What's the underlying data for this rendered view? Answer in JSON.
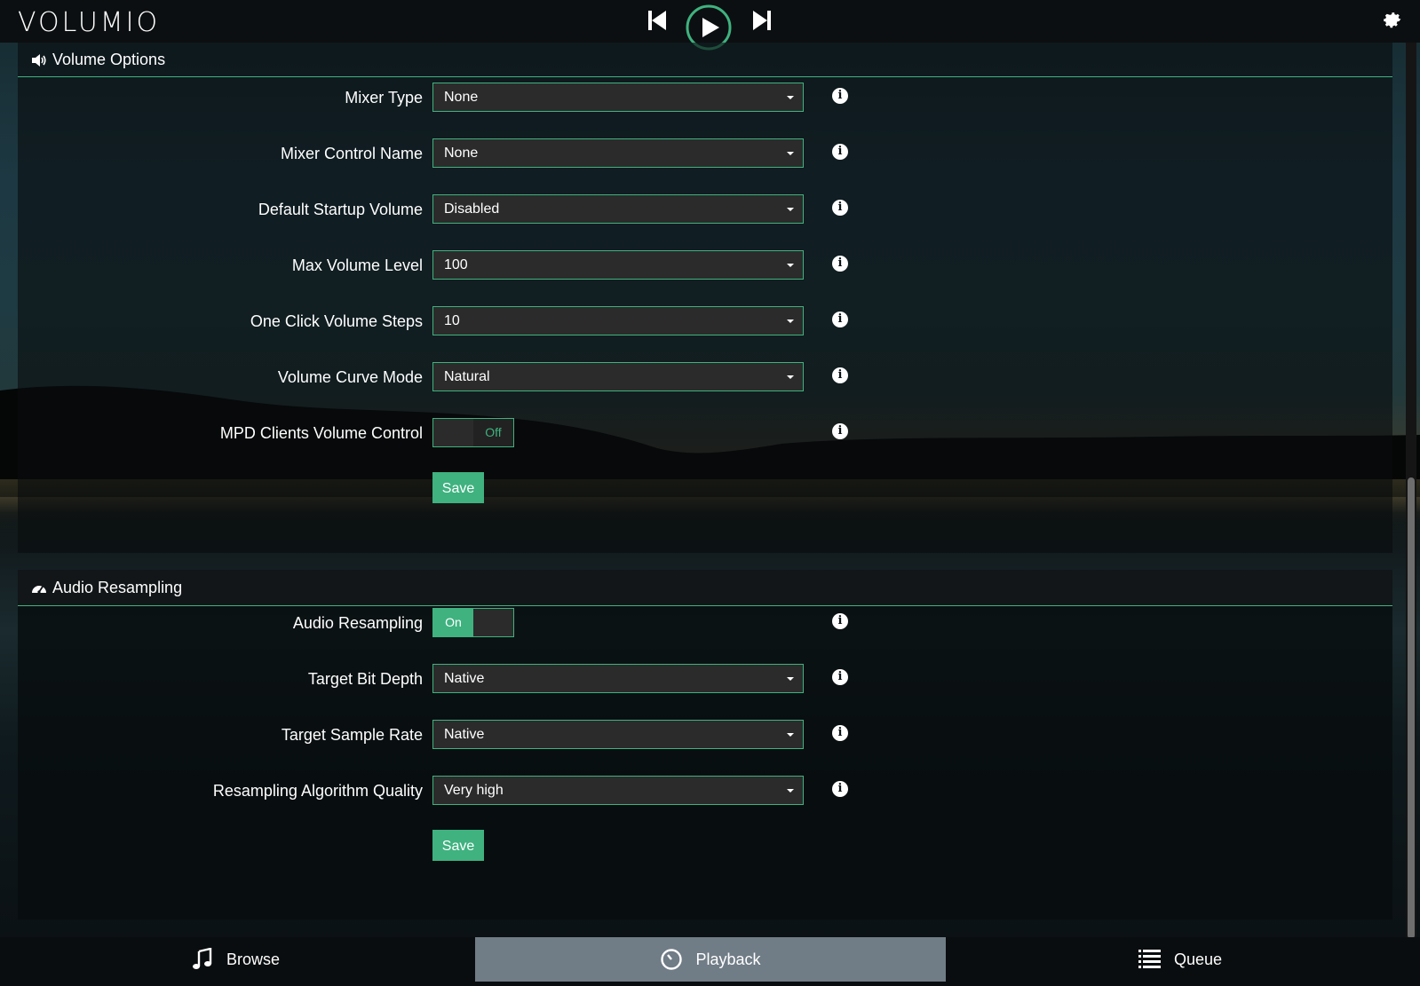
{
  "header": {
    "logo": "VOLUMIO",
    "controls": {
      "prev_icon": "skip-previous-icon",
      "play_icon": "play-icon",
      "next_icon": "skip-next-icon",
      "settings_icon": "gear-icon"
    }
  },
  "volume_options": {
    "title": "Volume Options",
    "icon": "volume-icon",
    "fields": [
      {
        "label": "Mixer Type",
        "value": "None"
      },
      {
        "label": "Mixer Control Name",
        "value": "None"
      },
      {
        "label": "Default Startup Volume",
        "value": "Disabled"
      },
      {
        "label": "Max Volume Level",
        "value": "100"
      },
      {
        "label": "One Click Volume Steps",
        "value": "10"
      },
      {
        "label": "Volume Curve Mode",
        "value": "Natural"
      }
    ],
    "mpd_toggle": {
      "label": "MPD Clients Volume Control",
      "on_text": "",
      "off_text": "Off",
      "state": "off"
    },
    "save_label": "Save"
  },
  "audio_resampling": {
    "title": "Audio Resampling",
    "icon": "dashboard-icon",
    "toggle": {
      "label": "Audio Resampling",
      "on_text": "On",
      "off_text": "",
      "state": "on"
    },
    "fields": [
      {
        "label": "Target Bit Depth",
        "value": "Native"
      },
      {
        "label": "Target Sample Rate",
        "value": "Native"
      },
      {
        "label": "Resampling Algorithm Quality",
        "value": "Very high"
      }
    ],
    "save_label": "Save"
  },
  "footer": {
    "tabs": [
      {
        "label": "Browse",
        "icon": "music-note-icon"
      },
      {
        "label": "Playback",
        "icon": "clock-icon",
        "active": true
      },
      {
        "label": "Queue",
        "icon": "list-icon"
      }
    ]
  },
  "colors": {
    "accent": "#3fb27f",
    "active_tab": "#707c86",
    "field_bg": "#2b2b2b"
  }
}
